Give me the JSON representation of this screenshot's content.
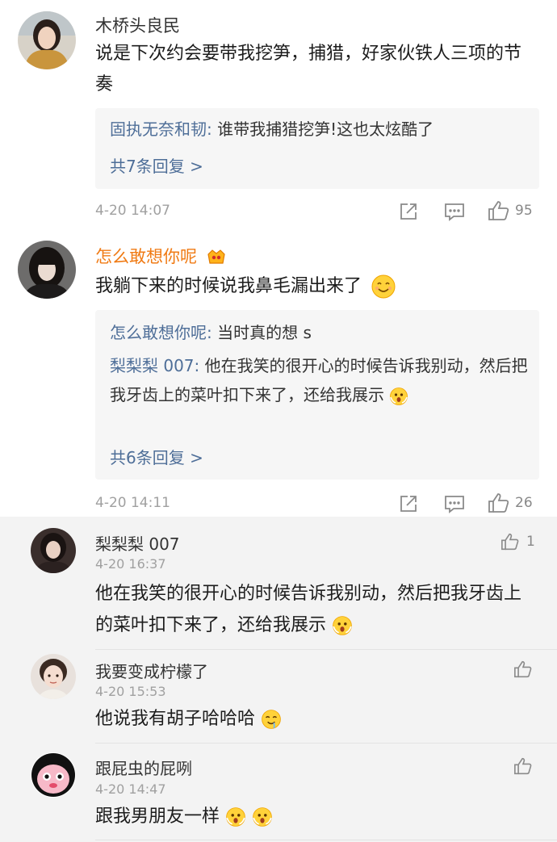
{
  "comments": [
    {
      "username": "木桥头良民",
      "text": "说是下次约会要带我挖笋，捕猎，好家伙铁人三项的节奏",
      "replies": [
        {
          "author": "固执无奈和韧:",
          "text": " 谁带我捕猎挖笋!这也太炫酷了"
        }
      ],
      "more_replies": "共7条回复 >",
      "time": "4-20 14:07",
      "likes": "95"
    },
    {
      "username": "怎么敢想你呢",
      "text": "我躺下来的时候说我鼻毛漏出来了",
      "replies": [
        {
          "author": "怎么敢想你呢:",
          "text": " 当时真的想 s"
        },
        {
          "author": "梨梨梨 007:",
          "text": " 他在我笑的很开心的时候告诉我别动，然后把我牙齿上的菜叶扣下来了，还给我展示"
        }
      ],
      "more_replies": "共6条回复 >",
      "time": "4-20 14:11",
      "likes": "26"
    }
  ],
  "sub_comments": [
    {
      "username": "梨梨梨 007",
      "time": "4-20 16:37",
      "text": "他在我笑的很开心的时候告诉我别动，然后把我牙齿上的菜叶扣下来了，还给我展示",
      "likes": "1"
    },
    {
      "username": "我要变成柠檬了",
      "time": "4-20 15:53",
      "text": "他说我有胡子哈哈哈",
      "likes": ""
    },
    {
      "username": "跟屁虫的屁咧",
      "time": "4-20 14:47",
      "text": "跟我男朋友一样",
      "likes": ""
    }
  ],
  "icons": [
    "share-icon",
    "comment-icon",
    "like-icon",
    "vip-badge-icon",
    "smile-emoji",
    "surprised-emoji",
    "drool-emoji"
  ],
  "colors": {
    "link": "#4e6e98",
    "vip_name": "#f07a13",
    "meta": "#a0a0a0",
    "reply_bg": "#f6f6f6"
  }
}
